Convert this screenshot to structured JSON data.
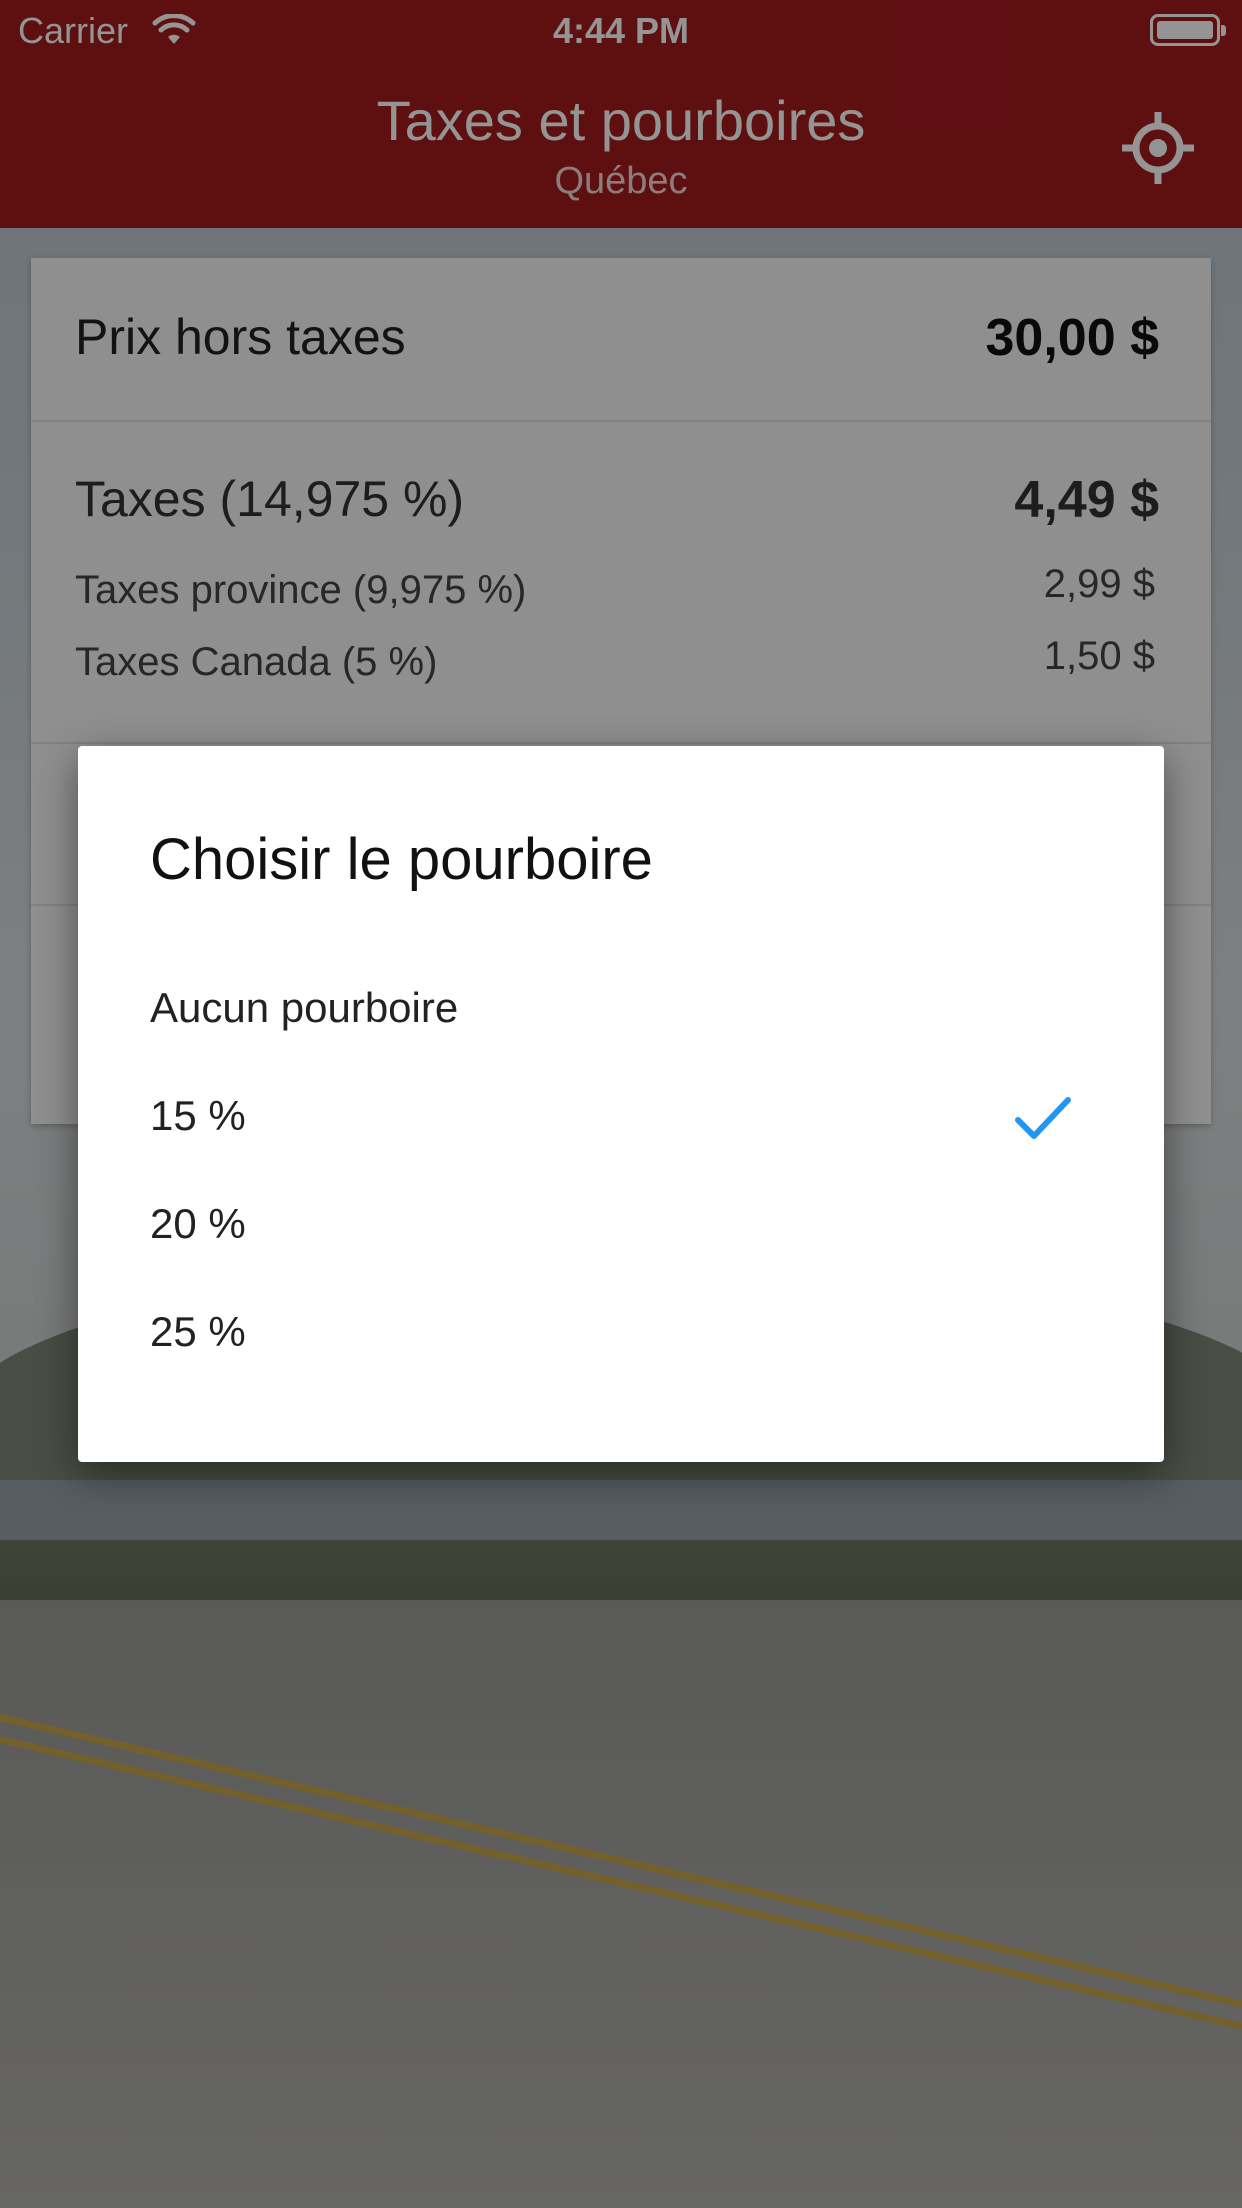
{
  "status_bar": {
    "carrier": "Carrier",
    "time": "4:44 PM"
  },
  "nav": {
    "title": "Taxes et pourboires",
    "subtitle": "Québec",
    "locate_icon": "locate-icon"
  },
  "card": {
    "price_label": "Prix hors taxes",
    "price_value": "30,00 $",
    "taxes_label": "Taxes (14,975 %)",
    "taxes_value": "4,49 $",
    "province_label": "Taxes province (9,975 %)",
    "province_value": "2,99 $",
    "canada_label": "Taxes Canada (5 %)",
    "canada_value": "1,50 $"
  },
  "dialog": {
    "title": "Choisir le pourboire",
    "options": [
      {
        "label": "Aucun pourboire",
        "selected": false
      },
      {
        "label": "15 %",
        "selected": true
      },
      {
        "label": "20 %",
        "selected": false
      },
      {
        "label": "25 %",
        "selected": false
      }
    ],
    "check_color": "#2196f3"
  },
  "colors": {
    "app_bar": "#a31a1d"
  }
}
